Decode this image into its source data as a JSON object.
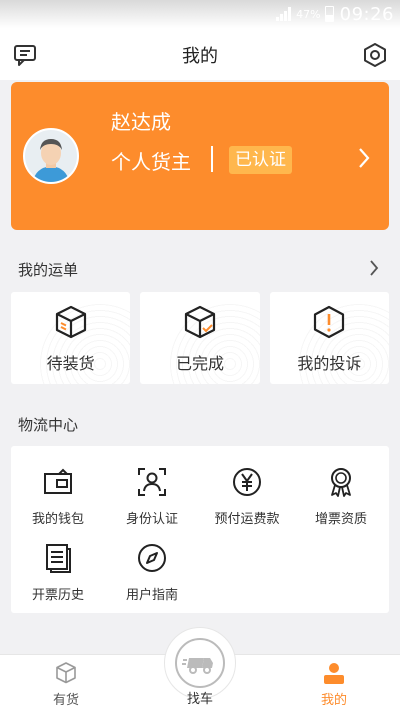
{
  "status_bar": {
    "battery": "47%",
    "time": "09:26"
  },
  "header": {
    "title": "我的",
    "left_icon": "message-icon",
    "right_icon": "settings-hex-icon"
  },
  "profile": {
    "name": "赵达成",
    "role": "个人货主",
    "badge": "已认证",
    "card_color": "#fd8c2c"
  },
  "orders": {
    "title": "我的运单",
    "items": [
      {
        "label": "待装货",
        "icon": "box-pending-icon"
      },
      {
        "label": "已完成",
        "icon": "box-done-icon"
      },
      {
        "label": "我的投诉",
        "icon": "complaint-icon"
      }
    ]
  },
  "logistics": {
    "title": "物流中心",
    "items": [
      {
        "label": "我的钱包",
        "icon": "wallet-icon"
      },
      {
        "label": "身份认证",
        "icon": "id-verify-icon"
      },
      {
        "label": "预付运费款",
        "icon": "yen-icon"
      },
      {
        "label": "增票资质",
        "icon": "award-icon"
      },
      {
        "label": "开票历史",
        "icon": "invoice-history-icon"
      },
      {
        "label": "用户指南",
        "icon": "compass-icon"
      }
    ]
  },
  "bottom_nav": {
    "items": [
      {
        "label": "有货",
        "icon": "cargo-icon"
      },
      {
        "label": "找车",
        "icon": "truck-icon"
      },
      {
        "label": "我的",
        "icon": "person-icon",
        "active": true
      }
    ],
    "active_color": "#fd8c2c"
  }
}
